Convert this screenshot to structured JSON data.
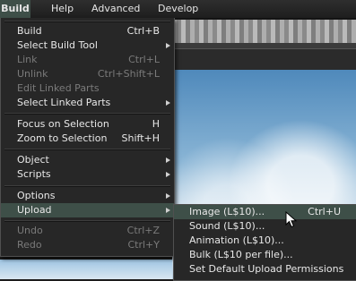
{
  "menubar": {
    "items": [
      {
        "label": "Build",
        "active": true
      },
      {
        "label": "Help",
        "active": false
      },
      {
        "label": "Advanced",
        "active": false
      },
      {
        "label": "Develop",
        "active": false
      }
    ]
  },
  "build_menu": {
    "items": [
      {
        "label": "Build",
        "shortcut": "Ctrl+B",
        "disabled": false
      },
      {
        "label": "Select Build Tool",
        "shortcut": "",
        "submenu": true,
        "disabled": false
      },
      {
        "label": "Link",
        "shortcut": "Ctrl+L",
        "disabled": true
      },
      {
        "label": "Unlink",
        "shortcut": "Ctrl+Shift+L",
        "disabled": true
      },
      {
        "label": "Edit Linked Parts",
        "shortcut": "",
        "disabled": true
      },
      {
        "label": "Select Linked Parts",
        "shortcut": "",
        "submenu": true,
        "disabled": false
      },
      {
        "label": "Focus on Selection",
        "shortcut": "H",
        "disabled": false
      },
      {
        "label": "Zoom to Selection",
        "shortcut": "Shift+H",
        "disabled": false
      },
      {
        "label": "Object",
        "shortcut": "",
        "submenu": true,
        "disabled": false
      },
      {
        "label": "Scripts",
        "shortcut": "",
        "submenu": true,
        "disabled": false
      },
      {
        "label": "Options",
        "shortcut": "",
        "submenu": true,
        "disabled": false
      },
      {
        "label": "Upload",
        "shortcut": "",
        "submenu": true,
        "disabled": false,
        "highlighted": true
      },
      {
        "label": "Undo",
        "shortcut": "Ctrl+Z",
        "disabled": true
      },
      {
        "label": "Redo",
        "shortcut": "Ctrl+Y",
        "disabled": true
      }
    ]
  },
  "upload_submenu": {
    "items": [
      {
        "label": "Image (L$10)...",
        "shortcut": "Ctrl+U",
        "highlighted": true
      },
      {
        "label": "Sound (L$10)...",
        "shortcut": ""
      },
      {
        "label": "Animation (L$10)...",
        "shortcut": ""
      },
      {
        "label": "Bulk (L$10 per file)...",
        "shortcut": ""
      },
      {
        "label": "Set Default Upload Permissions",
        "shortcut": ""
      }
    ]
  },
  "colors": {
    "highlight": "#3e4f48",
    "menu_bg": "#272727",
    "disabled_text": "#7a7a7a"
  },
  "icons": {
    "submenu_arrow": "triangle-right-icon",
    "cursor": "mouse-pointer-icon"
  }
}
